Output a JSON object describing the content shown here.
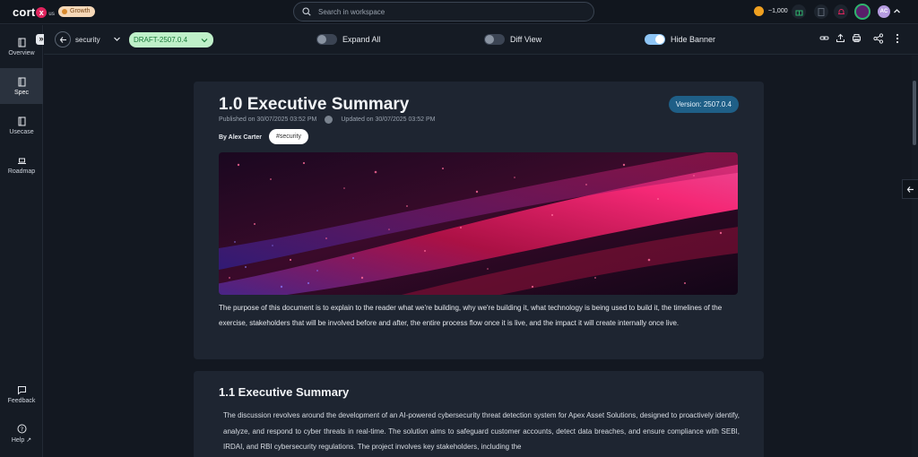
{
  "app": {
    "logo_text": "cort",
    "logo_mark": "x",
    "logo_suffix": "us",
    "plan_badge": "Growth",
    "credits": "~1,000",
    "avatar_initials": "AC"
  },
  "search": {
    "placeholder": "Search in workspace"
  },
  "sidebar": {
    "items": [
      {
        "label": "Overview",
        "icon": "book-icon",
        "active": false
      },
      {
        "label": "Spec",
        "icon": "spec-icon",
        "active": true
      },
      {
        "label": "Usecase",
        "icon": "book-icon",
        "active": false
      },
      {
        "label": "Roadmap",
        "icon": "laptop-icon",
        "active": false
      }
    ],
    "bottom": [
      {
        "label": "Feedback",
        "icon": "feedback-icon"
      },
      {
        "label": "Help",
        "icon": "help-icon"
      }
    ]
  },
  "toolbar": {
    "breadcrumb": "security",
    "draft_version": "DRAFT-2507.0.4",
    "toggles": [
      {
        "label": "Expand All",
        "on": false
      },
      {
        "label": "Diff View",
        "on": false
      },
      {
        "label": "Hide Banner",
        "on": true
      }
    ]
  },
  "doc": {
    "title": "1.0 Executive Summary",
    "version_badge": "Version: 2507.0.4",
    "published": "Published on 30/07/2025 03:52 PM",
    "updated": "Updated on 30/07/2025 03:52 PM",
    "author": "By Alex Carter",
    "tag": "#security",
    "intro": "The purpose of this document is to explain to the reader what we're building, why we're building it, what technology is being used to build it, the timelines of the exercise, stakeholders that will be involved before and after, the entire process flow once it is live, and the impact it will create internally once live.",
    "section_title": "1.1 Executive Summary",
    "section_body": "The discussion revolves around the development of an AI-powered cybersecurity threat detection system for Apex Asset Solutions, designed to proactively identify, analyze, and respond to cyber threats in real-time. The solution aims to safeguard customer accounts, detect data breaches, and ensure compliance with SEBI, IRDAI, and RBI cybersecurity regulations. The project involves key stakeholders, including the"
  },
  "colors": {
    "background": "#131821",
    "card": "#1e2531",
    "draft_pill": "#bff0c9",
    "version_badge": "#1f5f87",
    "logo_accent": "#e0245e"
  }
}
